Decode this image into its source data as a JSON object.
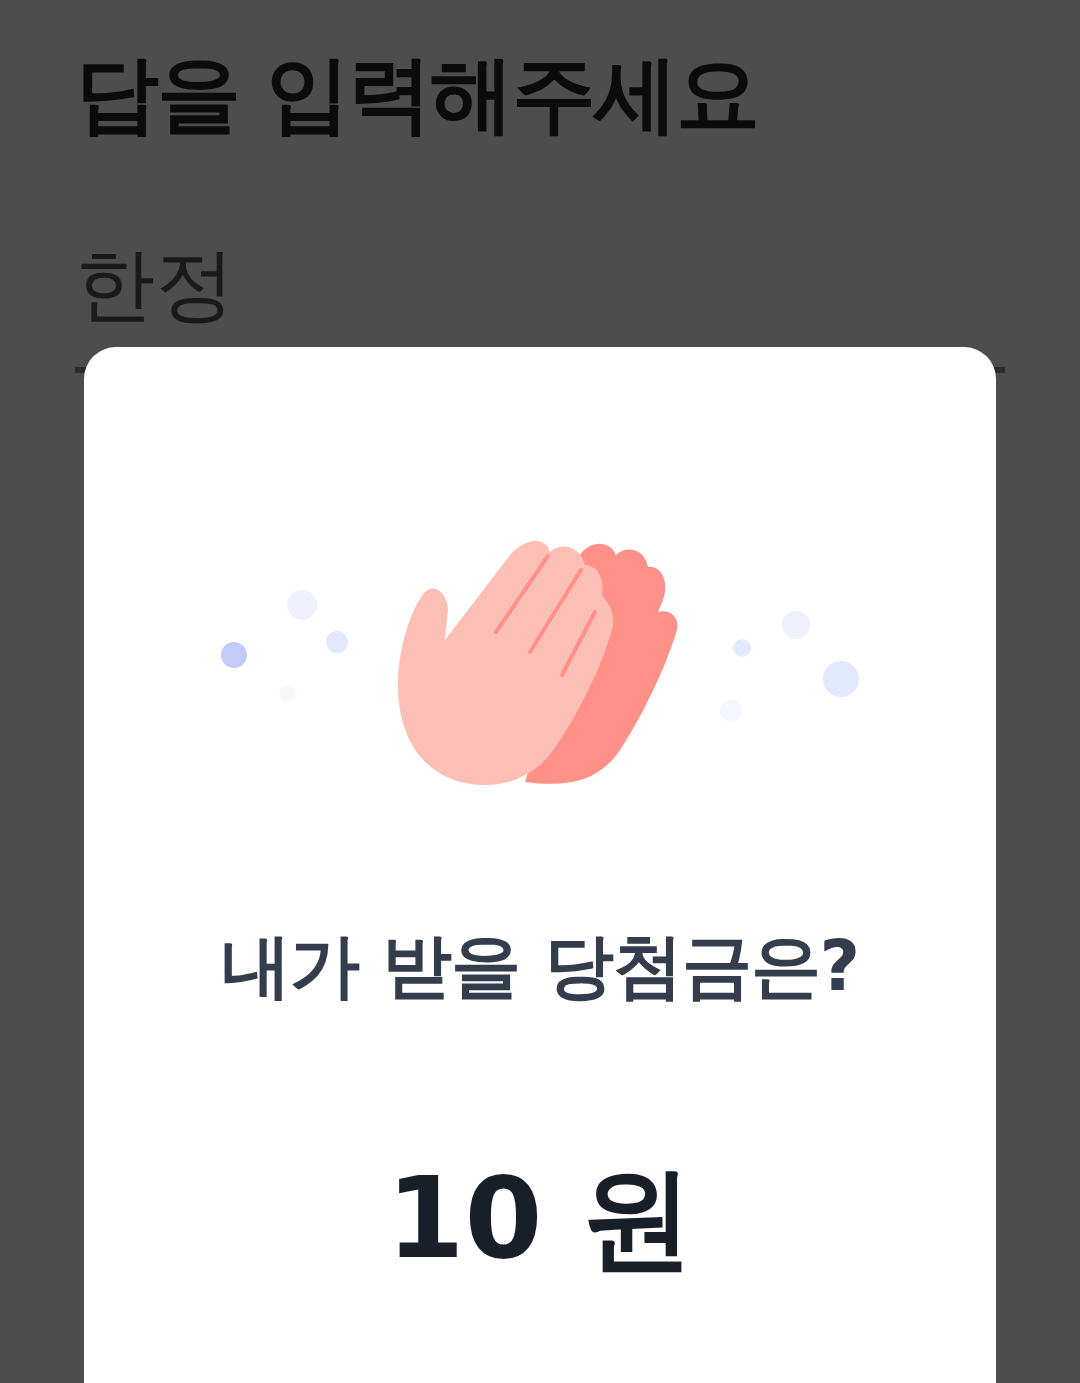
{
  "page": {
    "title": "답을 입력해주세요",
    "answer": {
      "value": "한정"
    }
  },
  "modal": {
    "question": "내가 받을 당첨금은?",
    "amount": "10 원"
  }
}
